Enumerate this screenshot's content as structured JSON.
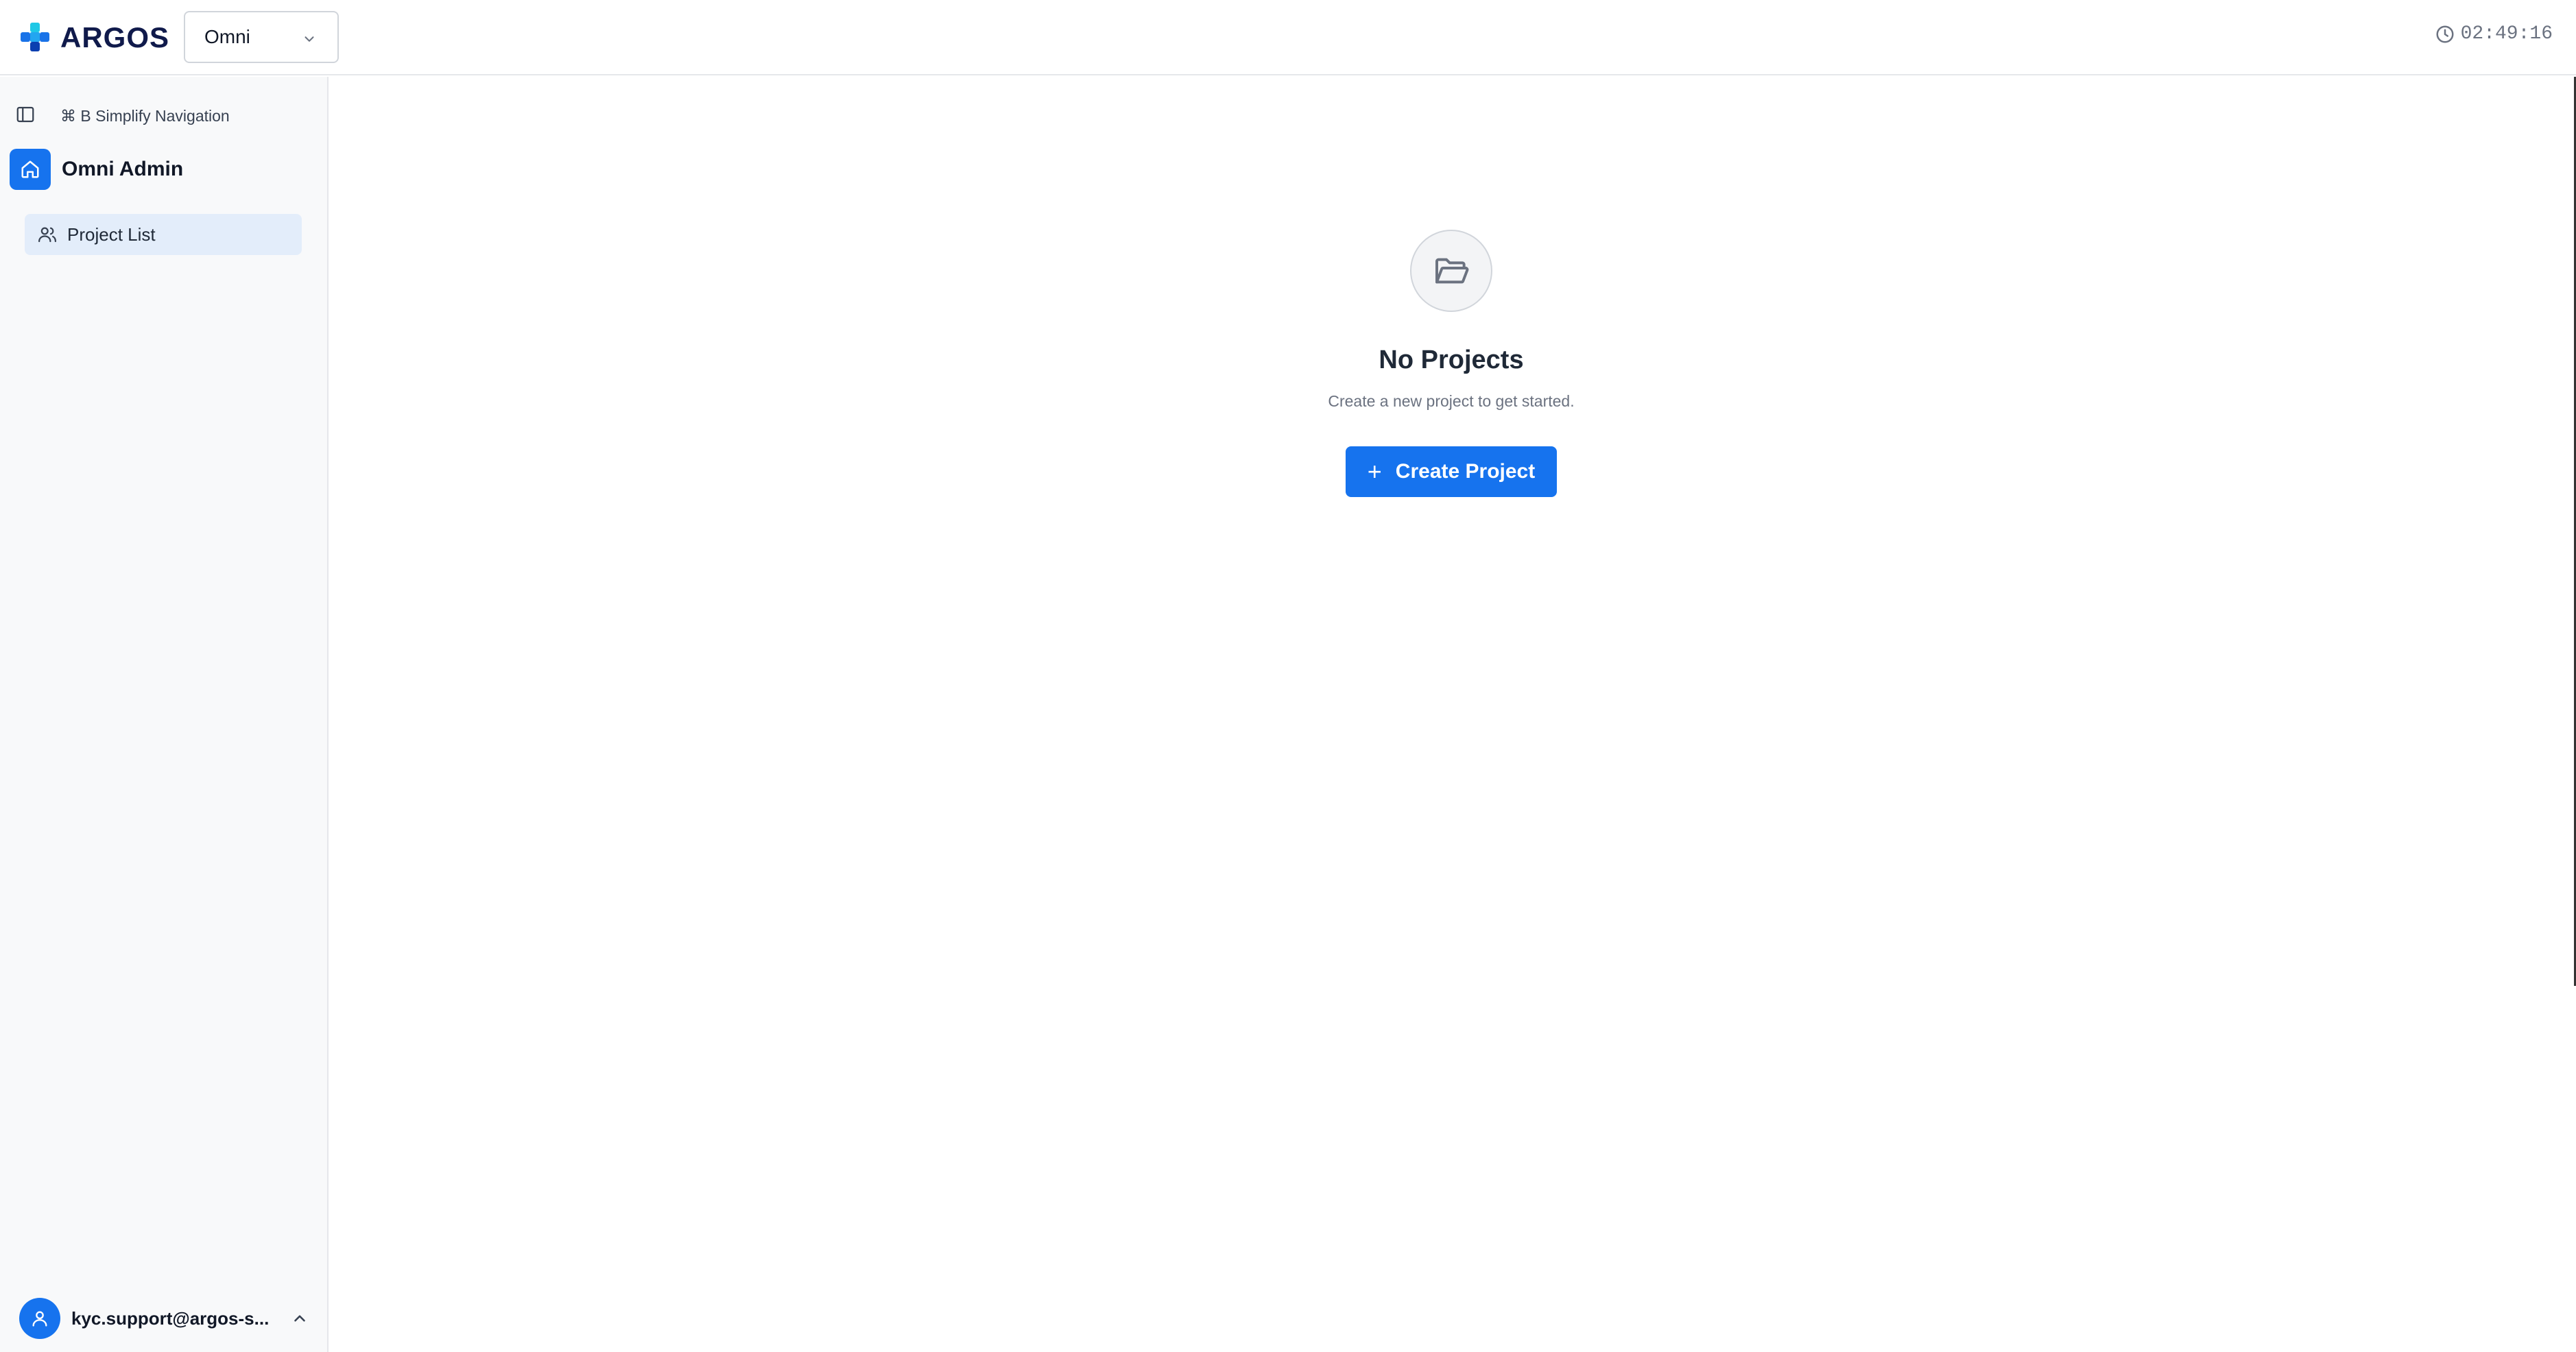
{
  "header": {
    "logo_text": "ARGOS",
    "org_select": {
      "value": "Omni"
    },
    "clock": "02:49:16"
  },
  "sidebar": {
    "shortcut_hint": "⌘ B Simplify Navigation",
    "workspace_name": "Omni Admin",
    "items": [
      {
        "label": "Project List",
        "icon": "users-icon",
        "active": true
      }
    ],
    "user_email": "kyc.support@argos-s..."
  },
  "main": {
    "empty_state": {
      "icon": "folder-open-icon",
      "title": "No Projects",
      "subtitle": "Create a new project to get started.",
      "button_label": "Create Project"
    }
  },
  "colors": {
    "accent": "#1673ee",
    "logo_text": "#101a4b",
    "active_nav_bg": "#e3edfa",
    "sidebar_bg": "#f8f9fa"
  }
}
